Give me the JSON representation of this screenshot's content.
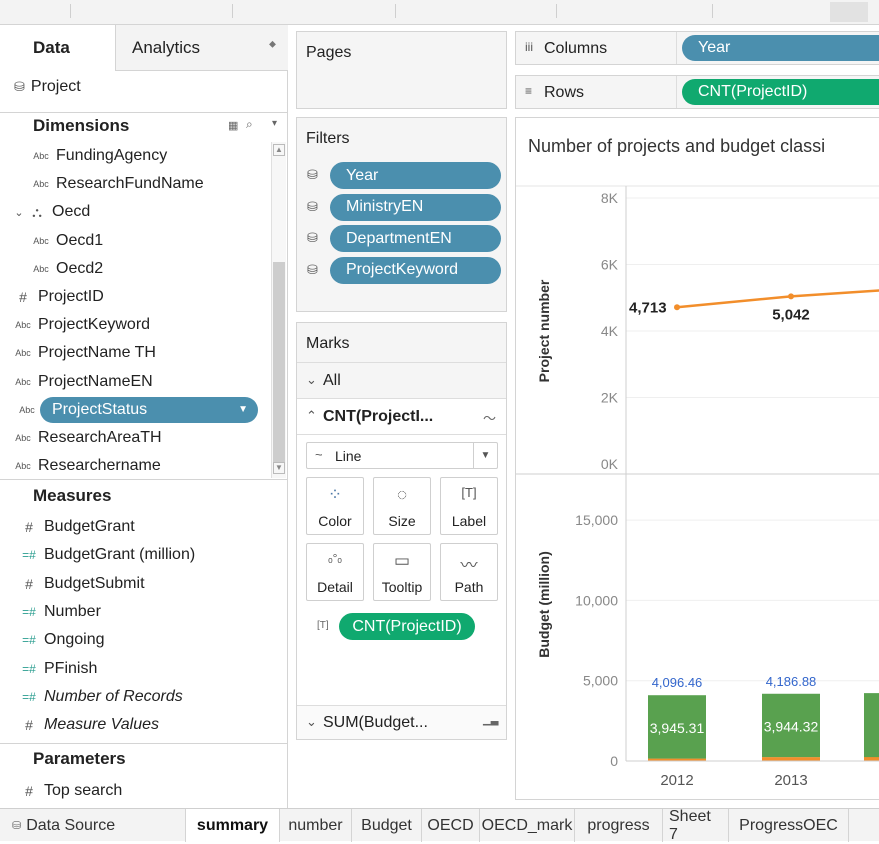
{
  "data_panel": {
    "tab_data": "Data",
    "tab_analytics": "Analytics",
    "datasource": "Project",
    "dimensions_title": "Dimensions",
    "measures_title": "Measures",
    "parameters_title": "Parameters",
    "dimension_fields": [
      {
        "type": "Abc",
        "label": "FundingAgency",
        "indent": true
      },
      {
        "type": "Abc",
        "label": "ResearchFundName",
        "indent": true
      },
      {
        "type": "hier",
        "label": "Oecd",
        "indent": false
      },
      {
        "type": "Abc",
        "label": "Oecd1",
        "indent": true
      },
      {
        "type": "Abc",
        "label": "Oecd2",
        "indent": true
      },
      {
        "type": "#",
        "label": "ProjectID",
        "indent": false
      },
      {
        "type": "Abc",
        "label": "ProjectKeyword",
        "indent": false
      },
      {
        "type": "Abc",
        "label": "ProjectName TH",
        "indent": false
      },
      {
        "type": "Abc",
        "label": "ProjectNameEN",
        "indent": false
      },
      {
        "type": "Abc",
        "label": "ProjectStatus",
        "indent": false,
        "selected": true
      },
      {
        "type": "Abc",
        "label": "ResearchAreaTH",
        "indent": false
      },
      {
        "type": "Abc",
        "label": "Researchername",
        "indent": false
      }
    ],
    "measure_fields": [
      {
        "type": "#",
        "label": "BudgetGrant",
        "italic": false
      },
      {
        "type": "=#",
        "label": "BudgetGrant (million)",
        "italic": false
      },
      {
        "type": "#",
        "label": "BudgetSubmit",
        "italic": false
      },
      {
        "type": "=#",
        "label": "Number",
        "italic": false
      },
      {
        "type": "=#",
        "label": "Ongoing",
        "italic": false
      },
      {
        "type": "=#",
        "label": "PFinish",
        "italic": false
      },
      {
        "type": "=#",
        "label": "Number of Records",
        "italic": true
      },
      {
        "type": "#",
        "label": "Measure Values",
        "italic": true
      }
    ],
    "parameter_fields": [
      {
        "type": "#",
        "label": "Top search"
      }
    ]
  },
  "pages": {
    "title": "Pages"
  },
  "filters": {
    "title": "Filters",
    "items": [
      "Year",
      "MinistryEN",
      "DepartmentEN",
      "ProjectKeyword"
    ]
  },
  "marks": {
    "title": "Marks",
    "all_label": "All",
    "card_label": "CNT(ProjectI...",
    "mark_type": "Line",
    "buttons": [
      "Color",
      "Size",
      "Label",
      "Detail",
      "Tooltip",
      "Path"
    ],
    "label_pill": "CNT(ProjectID)",
    "sum_label": "SUM(Budget..."
  },
  "shelves": {
    "columns_label": "Columns",
    "columns_pill": "Year",
    "rows_label": "Rows",
    "rows_pill": "CNT(ProjectID)"
  },
  "chart_data": {
    "type": "line",
    "title": "Number of projects and budget classi",
    "panes": [
      {
        "type": "line",
        "ylabel": "Project number",
        "ylim": [
          0,
          8000
        ],
        "ticks": [
          "0K",
          "2K",
          "4K",
          "6K",
          "8K"
        ],
        "tick_values": [
          0,
          2000,
          4000,
          6000,
          8000
        ],
        "x": [
          "2012",
          "2013"
        ],
        "values": [
          4713,
          5042
        ],
        "labels": [
          "4,713",
          "5,042"
        ],
        "color": "#f28e2b"
      },
      {
        "type": "bar",
        "ylabel": "Budget (million)",
        "ylim": [
          0,
          17000
        ],
        "ticks": [
          "0",
          "5,000",
          "10,000",
          "15,000"
        ],
        "tick_values": [
          0,
          5000,
          10000,
          15000
        ],
        "categories": [
          "2012",
          "2013"
        ],
        "stack_green": [
          3945.31,
          3944.32
        ],
        "stack_orange": [
          151.15,
          242.56
        ],
        "green_labels": [
          "3,945.31",
          "3,944.32"
        ],
        "total_labels": [
          "4,096.46",
          "4,186.88"
        ],
        "colors": {
          "green": "#59a14f",
          "orange": "#f28e2b",
          "total_label": "#3366cc"
        }
      }
    ]
  },
  "sheet_tabs": {
    "datasource": "Data Source",
    "tabs": [
      "summary",
      "number",
      "Budget",
      "OECD",
      "OECD_mark",
      "progress",
      "Sheet 7",
      "ProgressOEC"
    ],
    "active": "summary"
  }
}
